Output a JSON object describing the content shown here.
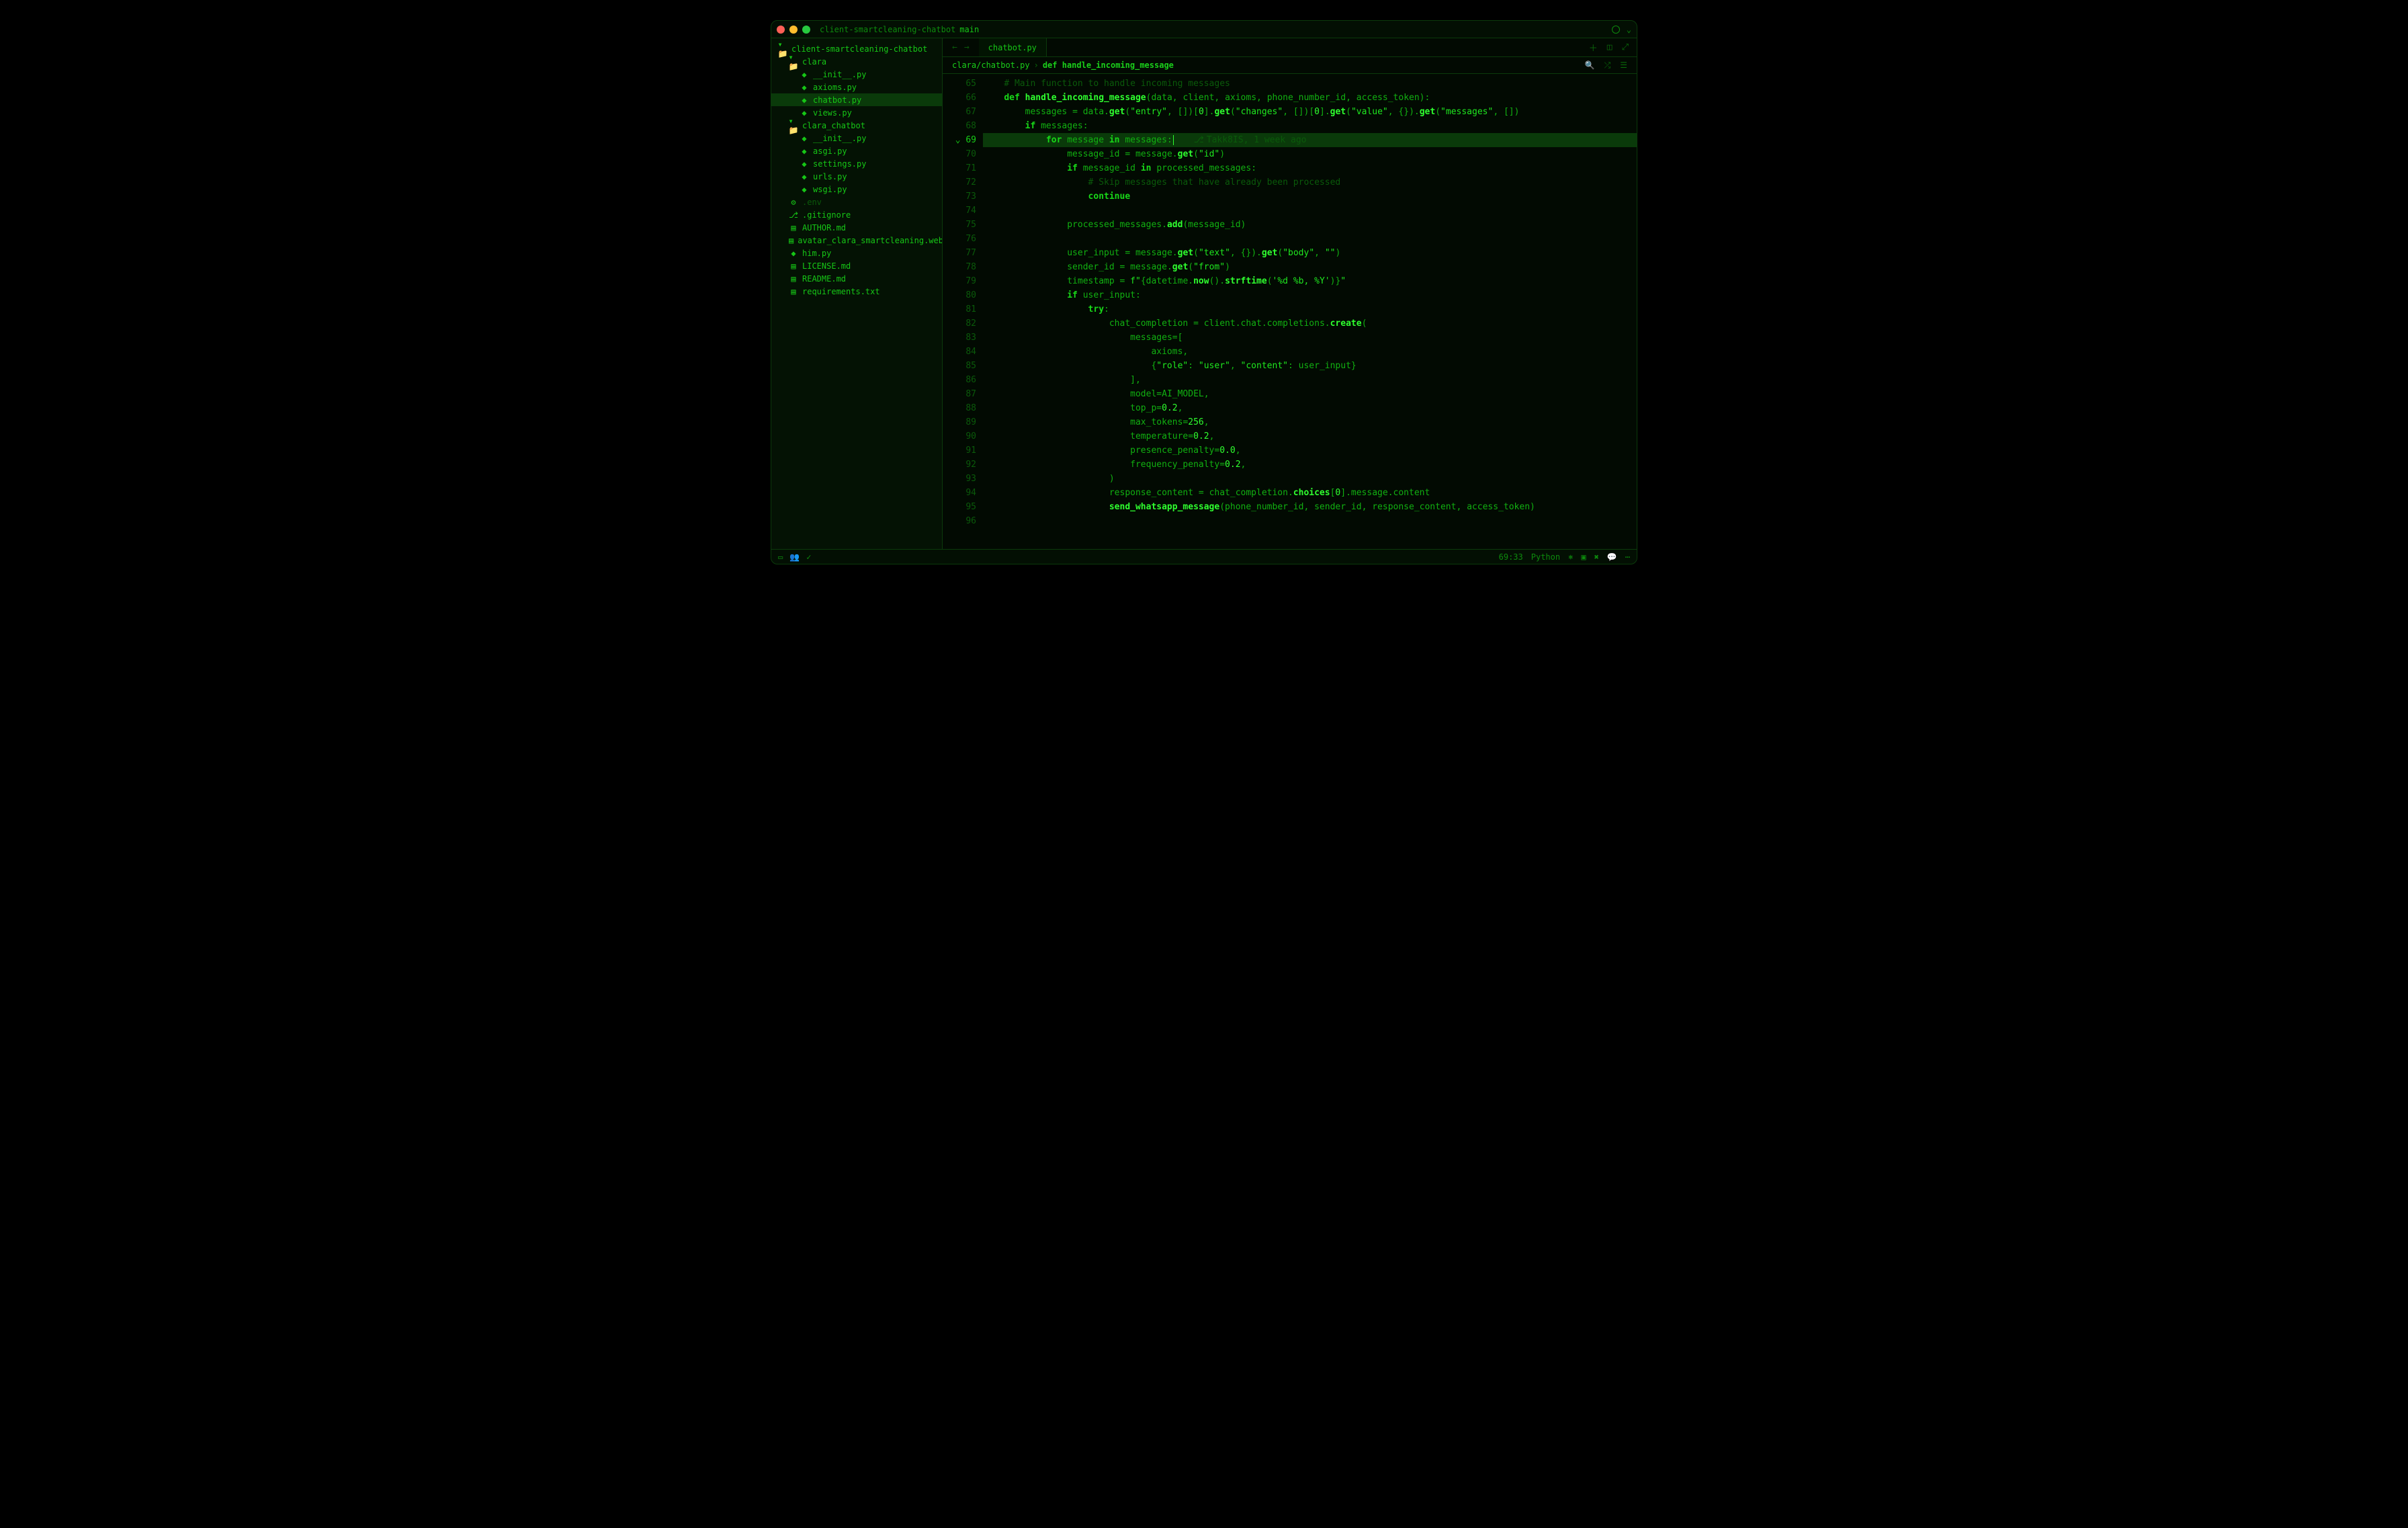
{
  "title": "client-smartcleaning-chatbot",
  "branch": "main",
  "sidebar": {
    "root": "client-smartcleaning-chatbot",
    "folders": [
      {
        "name": "clara",
        "depth": 1,
        "children": [
          {
            "name": "__init__.py"
          },
          {
            "name": "axioms.py"
          },
          {
            "name": "chatbot.py",
            "active": true
          },
          {
            "name": "views.py"
          }
        ]
      },
      {
        "name": "clara_chatbot",
        "depth": 1,
        "children": [
          {
            "name": "__init__.py"
          },
          {
            "name": "asgi.py"
          },
          {
            "name": "settings.py"
          },
          {
            "name": "urls.py"
          },
          {
            "name": "wsgi.py"
          }
        ]
      }
    ],
    "files": [
      {
        "name": ".env",
        "dim": true,
        "icon": "gear"
      },
      {
        "name": ".gitignore",
        "icon": "git"
      },
      {
        "name": "AUTHOR.md",
        "icon": "md"
      },
      {
        "name": "avatar_clara_smartcleaning.webp",
        "icon": "img"
      },
      {
        "name": "him.py",
        "icon": "py"
      },
      {
        "name": "LICENSE.md",
        "icon": "md"
      },
      {
        "name": "README.md",
        "icon": "md"
      },
      {
        "name": "requirements.txt",
        "icon": "txt"
      }
    ]
  },
  "tab": "chatbot.py",
  "breadcrumb": {
    "path": "clara/chatbot.py",
    "symbol": "def handle_incoming_message"
  },
  "gutter_start": 65,
  "blame": {
    "author": "Takk8IS",
    "when": "1 week ago"
  },
  "code_lines": [
    {
      "n": 65,
      "html": "    <span class='c-cm'># Main function to handle incoming messages</span>"
    },
    {
      "n": 66,
      "html": "    <span class='c-kw'>def</span> <span class='c-fn'>handle_incoming_message</span><span class='c-pn'>(</span><span class='c-id'>data</span><span class='c-pn'>, </span><span class='c-id'>client</span><span class='c-pn'>, </span><span class='c-id'>axioms</span><span class='c-pn'>, </span><span class='c-id'>phone_number_id</span><span class='c-pn'>, </span><span class='c-id'>access_token</span><span class='c-pn'>):</span>"
    },
    {
      "n": 67,
      "html": "        <span class='c-id'>messages</span> <span class='c-op'>=</span> <span class='c-id'>data</span><span class='c-pn'>.</span><span class='c-ca'>get</span><span class='c-pn'>(</span><span class='c-st'>\"entry\"</span><span class='c-pn'>, [])[</span><span class='c-nm'>0</span><span class='c-pn'>].</span><span class='c-ca'>get</span><span class='c-pn'>(</span><span class='c-st'>\"changes\"</span><span class='c-pn'>, [])[</span><span class='c-nm'>0</span><span class='c-pn'>].</span><span class='c-ca'>get</span><span class='c-pn'>(</span><span class='c-st'>\"value\"</span><span class='c-pn'>, {}).</span><span class='c-ca'>get</span><span class='c-pn'>(</span><span class='c-st'>\"messages\"</span><span class='c-pn'>, [])</span>"
    },
    {
      "n": 68,
      "html": "        <span class='c-kw'>if</span> <span class='c-id'>messages</span><span class='c-pn'>:</span>"
    },
    {
      "n": 69,
      "hl": true,
      "fold": true,
      "html": "            <span class='c-kw'>for</span> <span class='c-id'>message</span> <span class='c-kw'>in</span> <span class='c-id'>messages</span><span class='c-pn'>:</span><span class='cursor'></span><span class='c-blame'><span class='bicon'>⎇</span>Takk8IS, 1 week ago</span>"
    },
    {
      "n": 70,
      "html": "                <span class='c-id'>message_id</span> <span class='c-op'>=</span> <span class='c-id'>message</span><span class='c-pn'>.</span><span class='c-ca'>get</span><span class='c-pn'>(</span><span class='c-st'>\"id\"</span><span class='c-pn'>)</span>"
    },
    {
      "n": 71,
      "html": "                <span class='c-kw'>if</span> <span class='c-id'>message_id</span> <span class='c-kw'>in</span> <span class='c-id'>processed_messages</span><span class='c-pn'>:</span>"
    },
    {
      "n": 72,
      "html": "                    <span class='c-cm'># Skip messages that have already been processed</span>"
    },
    {
      "n": 73,
      "html": "                    <span class='c-kw'>continue</span>"
    },
    {
      "n": 74,
      "html": ""
    },
    {
      "n": 75,
      "html": "                <span class='c-id'>processed_messages</span><span class='c-pn'>.</span><span class='c-ca'>add</span><span class='c-pn'>(</span><span class='c-id'>message_id</span><span class='c-pn'>)</span>"
    },
    {
      "n": 76,
      "html": ""
    },
    {
      "n": 77,
      "html": "                <span class='c-id'>user_input</span> <span class='c-op'>=</span> <span class='c-id'>message</span><span class='c-pn'>.</span><span class='c-ca'>get</span><span class='c-pn'>(</span><span class='c-st'>\"text\"</span><span class='c-pn'>, {}).</span><span class='c-ca'>get</span><span class='c-pn'>(</span><span class='c-st'>\"body\"</span><span class='c-pn'>, </span><span class='c-st'>\"\"</span><span class='c-pn'>)</span>"
    },
    {
      "n": 78,
      "html": "                <span class='c-id'>sender_id</span> <span class='c-op'>=</span> <span class='c-id'>message</span><span class='c-pn'>.</span><span class='c-ca'>get</span><span class='c-pn'>(</span><span class='c-st'>\"from\"</span><span class='c-pn'>)</span>"
    },
    {
      "n": 79,
      "html": "                <span class='c-id'>timestamp</span> <span class='c-op'>=</span> <span class='c-st'>f\"</span><span class='c-pn'>{</span><span class='c-id'>datetime</span><span class='c-pn'>.</span><span class='c-ca'>now</span><span class='c-pn'>().</span><span class='c-ca'>strftime</span><span class='c-pn'>(</span><span class='c-st'>'%d %b, %Y'</span><span class='c-pn'>)}</span><span class='c-st'>\"</span>"
    },
    {
      "n": 80,
      "html": "                <span class='c-kw'>if</span> <span class='c-id'>user_input</span><span class='c-pn'>:</span>"
    },
    {
      "n": 81,
      "html": "                    <span class='c-kw'>try</span><span class='c-pn'>:</span>"
    },
    {
      "n": 82,
      "html": "                        <span class='c-id'>chat_completion</span> <span class='c-op'>=</span> <span class='c-id'>client</span><span class='c-pn'>.</span><span class='c-id'>chat</span><span class='c-pn'>.</span><span class='c-id'>completions</span><span class='c-pn'>.</span><span class='c-ca'>create</span><span class='c-pn'>(</span>"
    },
    {
      "n": 83,
      "html": "                            <span class='c-id'>messages</span><span class='c-op'>=</span><span class='c-pn'>[</span>"
    },
    {
      "n": 84,
      "html": "                                <span class='c-id'>axioms</span><span class='c-pn'>,</span>"
    },
    {
      "n": 85,
      "html": "                                <span class='c-pn'>{</span><span class='c-st'>\"role\"</span><span class='c-pn'>: </span><span class='c-st'>\"user\"</span><span class='c-pn'>, </span><span class='c-st'>\"content\"</span><span class='c-pn'>: </span><span class='c-id'>user_input</span><span class='c-pn'>}</span>"
    },
    {
      "n": 86,
      "html": "                            <span class='c-pn'>],</span>"
    },
    {
      "n": 87,
      "html": "                            <span class='c-id'>model</span><span class='c-op'>=</span><span class='c-id'>AI_MODEL</span><span class='c-pn'>,</span>"
    },
    {
      "n": 88,
      "html": "                            <span class='c-id'>top_p</span><span class='c-op'>=</span><span class='c-nm'>0.2</span><span class='c-pn'>,</span>"
    },
    {
      "n": 89,
      "html": "                            <span class='c-id'>max_tokens</span><span class='c-op'>=</span><span class='c-nm'>256</span><span class='c-pn'>,</span>"
    },
    {
      "n": 90,
      "html": "                            <span class='c-id'>temperature</span><span class='c-op'>=</span><span class='c-nm'>0.2</span><span class='c-pn'>,</span>"
    },
    {
      "n": 91,
      "html": "                            <span class='c-id'>presence_penalty</span><span class='c-op'>=</span><span class='c-nm'>0.0</span><span class='c-pn'>,</span>"
    },
    {
      "n": 92,
      "html": "                            <span class='c-id'>frequency_penalty</span><span class='c-op'>=</span><span class='c-nm'>0.2</span><span class='c-pn'>,</span>"
    },
    {
      "n": 93,
      "html": "                        <span class='c-pn'>)</span>"
    },
    {
      "n": 94,
      "html": "                        <span class='c-id'>response_content</span> <span class='c-op'>=</span> <span class='c-id'>chat_completion</span><span class='c-pn'>.</span><span class='c-ca'>choices</span><span class='c-pn'>[</span><span class='c-nm'>0</span><span class='c-pn'>].</span><span class='c-id'>message</span><span class='c-pn'>.</span><span class='c-id'>content</span>"
    },
    {
      "n": 95,
      "html": "                        <span class='c-fn'>send_whatsapp_message</span><span class='c-pn'>(</span><span class='c-id'>phone_number_id</span><span class='c-pn'>, </span><span class='c-id'>sender_id</span><span class='c-pn'>, </span><span class='c-id'>response_content</span><span class='c-pn'>, </span><span class='c-id'>access_token</span><span class='c-pn'>)</span>"
    },
    {
      "n": 96,
      "html": ""
    }
  ],
  "status": {
    "pos": "69:33",
    "language": "Python"
  }
}
